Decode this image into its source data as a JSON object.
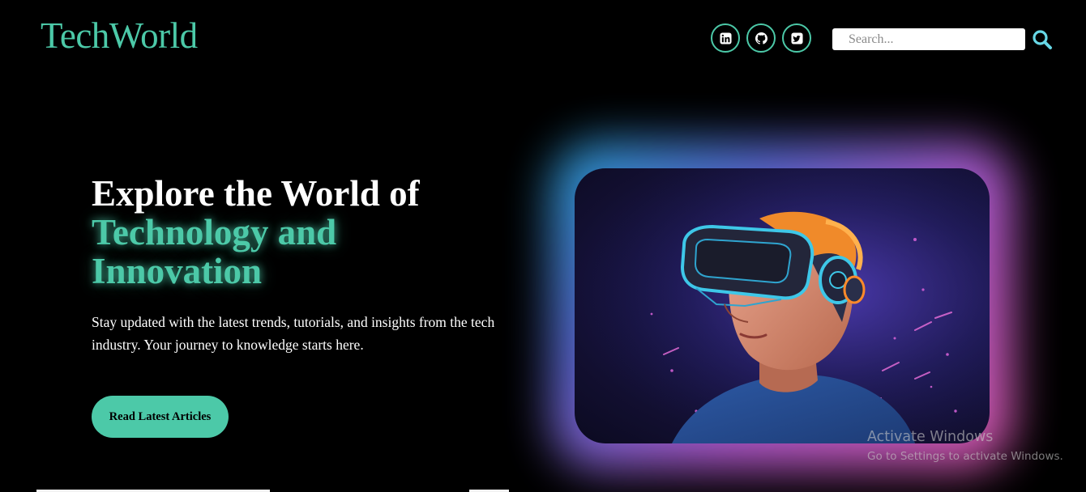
{
  "header": {
    "logo": "TechWorld",
    "social": [
      {
        "icon": "linkedin-icon"
      },
      {
        "icon": "github-icon"
      },
      {
        "icon": "twitter-icon"
      }
    ],
    "search": {
      "placeholder": "Search...",
      "value": "",
      "icon": "search-icon"
    }
  },
  "hero": {
    "title_line1": "Explore the World of",
    "title_accent": "Technology and Innovation",
    "description": "Stay updated with the latest trends, tutorials, and insights from the tech industry. Your journey to knowledge starts here.",
    "cta_label": "Read Latest Articles",
    "image_alt": "person-with-vr-headset"
  },
  "watermark": {
    "title": "Activate Windows",
    "subtitle": "Go to Settings to activate Windows."
  },
  "colors": {
    "accent": "#4cc9a8",
    "background": "#000000",
    "glow_start": "#25a6d9",
    "glow_end": "#e25bb2"
  }
}
